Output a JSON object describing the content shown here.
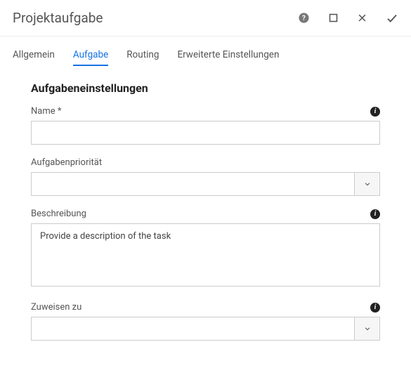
{
  "header": {
    "title": "Projektaufgabe"
  },
  "tabs": {
    "general": "Allgemein",
    "task": "Aufgabe",
    "routing": "Routing",
    "advanced": "Erweiterte Einstellungen"
  },
  "section": {
    "title": "Aufgabeneinstellungen"
  },
  "fields": {
    "name": {
      "label": "Name *",
      "value": ""
    },
    "priority": {
      "label": "Aufgabenpriorität",
      "value": ""
    },
    "description": {
      "label": "Beschreibung",
      "placeholder": "Provide a description of the task",
      "value": ""
    },
    "assign": {
      "label": "Zuweisen zu",
      "value": ""
    }
  }
}
